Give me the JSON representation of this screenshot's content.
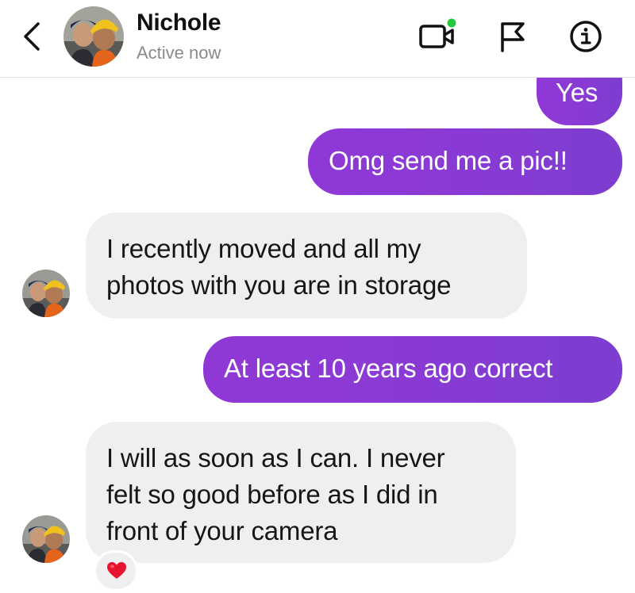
{
  "header": {
    "contact_name": "Nichole",
    "status": "Active now",
    "status_color": "#26c840",
    "icons": [
      "back-chevron-icon",
      "video-call-icon",
      "flag-icon",
      "info-icon"
    ]
  },
  "messages": [
    {
      "direction": "sent",
      "text": "Yes"
    },
    {
      "direction": "sent",
      "text": "Omg send me a pic!!"
    },
    {
      "direction": "received",
      "lines": [
        "I recently moved and all my",
        "photos with you are in storage"
      ]
    },
    {
      "direction": "sent",
      "text": "At least 10 years ago correct"
    },
    {
      "direction": "received",
      "lines": [
        "I will as soon as I can. I never",
        "felt so good before as I did in",
        "front of your camera"
      ],
      "reaction": "heart"
    }
  ],
  "colors": {
    "sent_bubble": "#8a3ad4",
    "received_bubble": "#efefef",
    "reaction_heart": "#e8132f"
  }
}
